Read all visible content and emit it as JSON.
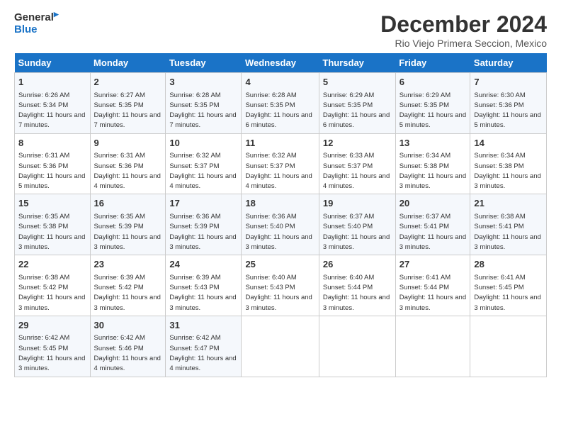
{
  "logo": {
    "line1": "General",
    "line2": "Blue"
  },
  "title": "December 2024",
  "subtitle": "Rio Viejo Primera Seccion, Mexico",
  "days_of_week": [
    "Sunday",
    "Monday",
    "Tuesday",
    "Wednesday",
    "Thursday",
    "Friday",
    "Saturday"
  ],
  "weeks": [
    [
      {
        "day": "1",
        "sunrise": "Sunrise: 6:26 AM",
        "sunset": "Sunset: 5:34 PM",
        "daylight": "Daylight: 11 hours and 7 minutes."
      },
      {
        "day": "2",
        "sunrise": "Sunrise: 6:27 AM",
        "sunset": "Sunset: 5:35 PM",
        "daylight": "Daylight: 11 hours and 7 minutes."
      },
      {
        "day": "3",
        "sunrise": "Sunrise: 6:28 AM",
        "sunset": "Sunset: 5:35 PM",
        "daylight": "Daylight: 11 hours and 7 minutes."
      },
      {
        "day": "4",
        "sunrise": "Sunrise: 6:28 AM",
        "sunset": "Sunset: 5:35 PM",
        "daylight": "Daylight: 11 hours and 6 minutes."
      },
      {
        "day": "5",
        "sunrise": "Sunrise: 6:29 AM",
        "sunset": "Sunset: 5:35 PM",
        "daylight": "Daylight: 11 hours and 6 minutes."
      },
      {
        "day": "6",
        "sunrise": "Sunrise: 6:29 AM",
        "sunset": "Sunset: 5:35 PM",
        "daylight": "Daylight: 11 hours and 5 minutes."
      },
      {
        "day": "7",
        "sunrise": "Sunrise: 6:30 AM",
        "sunset": "Sunset: 5:36 PM",
        "daylight": "Daylight: 11 hours and 5 minutes."
      }
    ],
    [
      {
        "day": "8",
        "sunrise": "Sunrise: 6:31 AM",
        "sunset": "Sunset: 5:36 PM",
        "daylight": "Daylight: 11 hours and 5 minutes."
      },
      {
        "day": "9",
        "sunrise": "Sunrise: 6:31 AM",
        "sunset": "Sunset: 5:36 PM",
        "daylight": "Daylight: 11 hours and 4 minutes."
      },
      {
        "day": "10",
        "sunrise": "Sunrise: 6:32 AM",
        "sunset": "Sunset: 5:37 PM",
        "daylight": "Daylight: 11 hours and 4 minutes."
      },
      {
        "day": "11",
        "sunrise": "Sunrise: 6:32 AM",
        "sunset": "Sunset: 5:37 PM",
        "daylight": "Daylight: 11 hours and 4 minutes."
      },
      {
        "day": "12",
        "sunrise": "Sunrise: 6:33 AM",
        "sunset": "Sunset: 5:37 PM",
        "daylight": "Daylight: 11 hours and 4 minutes."
      },
      {
        "day": "13",
        "sunrise": "Sunrise: 6:34 AM",
        "sunset": "Sunset: 5:38 PM",
        "daylight": "Daylight: 11 hours and 3 minutes."
      },
      {
        "day": "14",
        "sunrise": "Sunrise: 6:34 AM",
        "sunset": "Sunset: 5:38 PM",
        "daylight": "Daylight: 11 hours and 3 minutes."
      }
    ],
    [
      {
        "day": "15",
        "sunrise": "Sunrise: 6:35 AM",
        "sunset": "Sunset: 5:38 PM",
        "daylight": "Daylight: 11 hours and 3 minutes."
      },
      {
        "day": "16",
        "sunrise": "Sunrise: 6:35 AM",
        "sunset": "Sunset: 5:39 PM",
        "daylight": "Daylight: 11 hours and 3 minutes."
      },
      {
        "day": "17",
        "sunrise": "Sunrise: 6:36 AM",
        "sunset": "Sunset: 5:39 PM",
        "daylight": "Daylight: 11 hours and 3 minutes."
      },
      {
        "day": "18",
        "sunrise": "Sunrise: 6:36 AM",
        "sunset": "Sunset: 5:40 PM",
        "daylight": "Daylight: 11 hours and 3 minutes."
      },
      {
        "day": "19",
        "sunrise": "Sunrise: 6:37 AM",
        "sunset": "Sunset: 5:40 PM",
        "daylight": "Daylight: 11 hours and 3 minutes."
      },
      {
        "day": "20",
        "sunrise": "Sunrise: 6:37 AM",
        "sunset": "Sunset: 5:41 PM",
        "daylight": "Daylight: 11 hours and 3 minutes."
      },
      {
        "day": "21",
        "sunrise": "Sunrise: 6:38 AM",
        "sunset": "Sunset: 5:41 PM",
        "daylight": "Daylight: 11 hours and 3 minutes."
      }
    ],
    [
      {
        "day": "22",
        "sunrise": "Sunrise: 6:38 AM",
        "sunset": "Sunset: 5:42 PM",
        "daylight": "Daylight: 11 hours and 3 minutes."
      },
      {
        "day": "23",
        "sunrise": "Sunrise: 6:39 AM",
        "sunset": "Sunset: 5:42 PM",
        "daylight": "Daylight: 11 hours and 3 minutes."
      },
      {
        "day": "24",
        "sunrise": "Sunrise: 6:39 AM",
        "sunset": "Sunset: 5:43 PM",
        "daylight": "Daylight: 11 hours and 3 minutes."
      },
      {
        "day": "25",
        "sunrise": "Sunrise: 6:40 AM",
        "sunset": "Sunset: 5:43 PM",
        "daylight": "Daylight: 11 hours and 3 minutes."
      },
      {
        "day": "26",
        "sunrise": "Sunrise: 6:40 AM",
        "sunset": "Sunset: 5:44 PM",
        "daylight": "Daylight: 11 hours and 3 minutes."
      },
      {
        "day": "27",
        "sunrise": "Sunrise: 6:41 AM",
        "sunset": "Sunset: 5:44 PM",
        "daylight": "Daylight: 11 hours and 3 minutes."
      },
      {
        "day": "28",
        "sunrise": "Sunrise: 6:41 AM",
        "sunset": "Sunset: 5:45 PM",
        "daylight": "Daylight: 11 hours and 3 minutes."
      }
    ],
    [
      {
        "day": "29",
        "sunrise": "Sunrise: 6:42 AM",
        "sunset": "Sunset: 5:45 PM",
        "daylight": "Daylight: 11 hours and 3 minutes."
      },
      {
        "day": "30",
        "sunrise": "Sunrise: 6:42 AM",
        "sunset": "Sunset: 5:46 PM",
        "daylight": "Daylight: 11 hours and 4 minutes."
      },
      {
        "day": "31",
        "sunrise": "Sunrise: 6:42 AM",
        "sunset": "Sunset: 5:47 PM",
        "daylight": "Daylight: 11 hours and 4 minutes."
      },
      null,
      null,
      null,
      null
    ]
  ]
}
